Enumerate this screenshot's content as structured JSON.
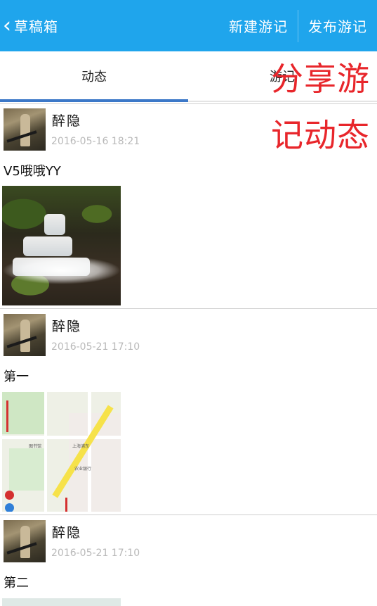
{
  "header": {
    "back_label": "草稿箱",
    "new_button": "新建游记",
    "publish_button": "发布游记"
  },
  "tabs": [
    {
      "label": "动态",
      "active": true
    },
    {
      "label": "游记",
      "active": false
    }
  ],
  "overlay": {
    "line1": "分享游",
    "line2": "记动态",
    "color": "#e8262b"
  },
  "posts": [
    {
      "username": "醉隐",
      "time": "2016-05-16 18:21",
      "text": "V5哦哦YY",
      "image": "waterfall-photo"
    },
    {
      "username": "醉隐",
      "time": "2016-05-21 17:10",
      "text": "第一",
      "image": "map-snapshot"
    },
    {
      "username": "醉隐",
      "time": "2016-05-21 17:10",
      "text": "第二",
      "image": "map-snapshot"
    }
  ],
  "colors": {
    "header_bg": "#1fa5ec",
    "tab_indicator": "#3c78c8",
    "timestamp": "#b9b9b9"
  }
}
